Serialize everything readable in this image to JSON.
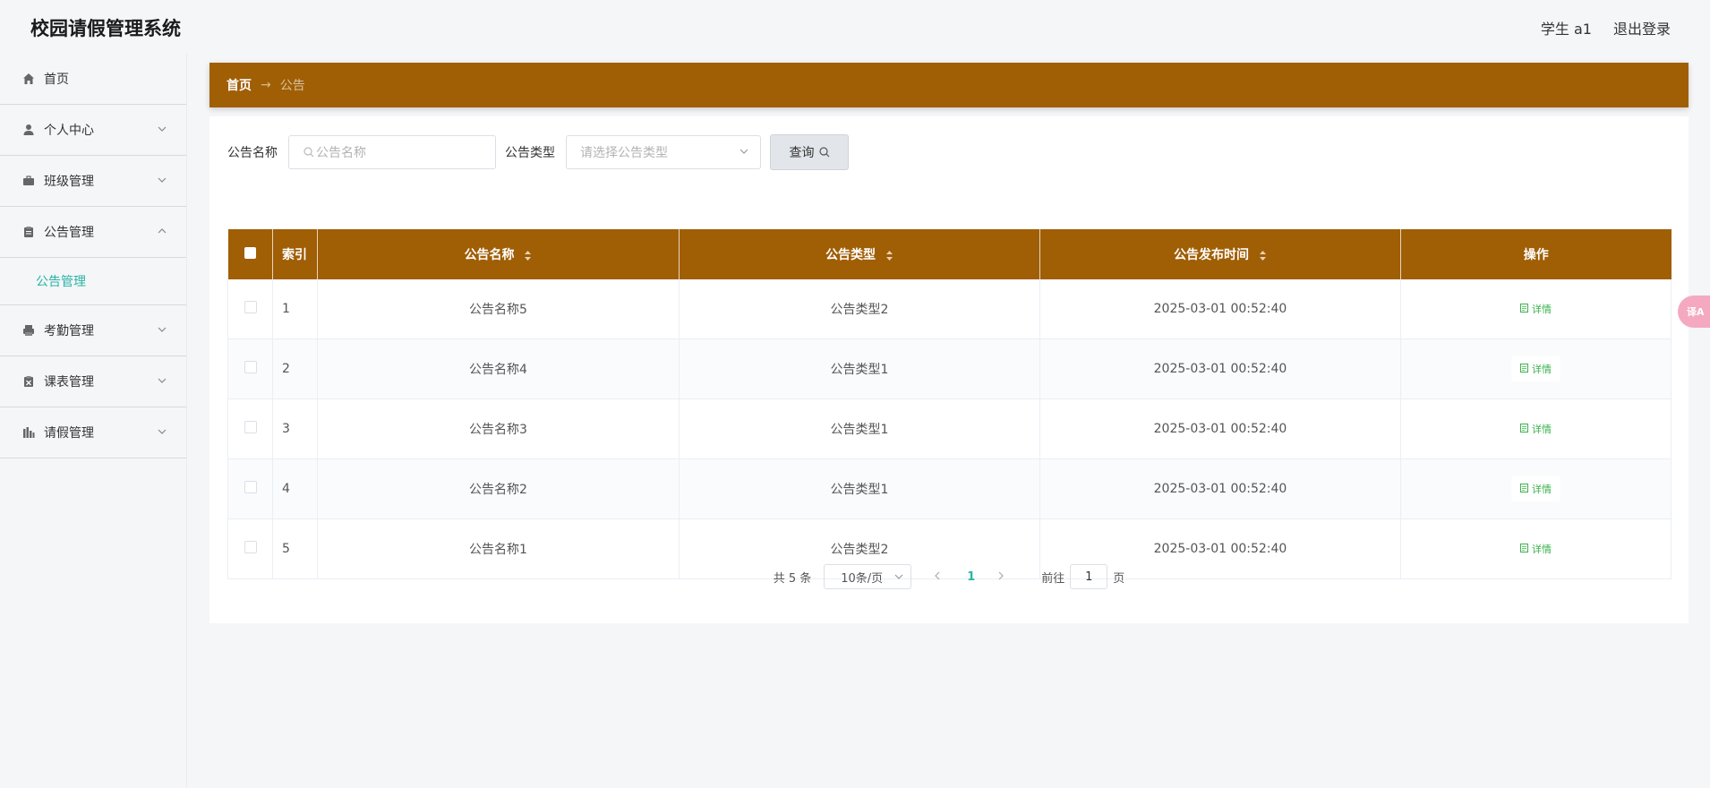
{
  "app": {
    "title": "校园请假管理系统"
  },
  "user": {
    "role_label": "学生 a1",
    "logout_label": "退出登录"
  },
  "sidebar": {
    "items": [
      {
        "label": "首页",
        "icon": "home-icon"
      },
      {
        "label": "个人中心",
        "icon": "user-icon"
      },
      {
        "label": "班级管理",
        "icon": "briefcase-icon"
      },
      {
        "label": "公告管理",
        "icon": "clipboard-icon",
        "expanded": true,
        "children": [
          {
            "label": "公告管理",
            "active": true
          }
        ]
      },
      {
        "label": "考勤管理",
        "icon": "printer-icon"
      },
      {
        "label": "课表管理",
        "icon": "checklist-icon"
      },
      {
        "label": "请假管理",
        "icon": "chart-icon"
      }
    ]
  },
  "breadcrumb": {
    "home": "首页",
    "separator": "→",
    "current": "公告"
  },
  "search": {
    "name_label": "公告名称",
    "name_placeholder": "公告名称",
    "type_label": "公告类型",
    "type_placeholder": "请选择公告类型",
    "query_label": "查询"
  },
  "table": {
    "columns": [
      "索引",
      "公告名称",
      "公告类型",
      "公告发布时间",
      "操作"
    ],
    "action_label": "详情",
    "rows": [
      {
        "index": "1",
        "name": "公告名称5",
        "type": "公告类型2",
        "time": "2025-03-01 00:52:40"
      },
      {
        "index": "2",
        "name": "公告名称4",
        "type": "公告类型1",
        "time": "2025-03-01 00:52:40"
      },
      {
        "index": "3",
        "name": "公告名称3",
        "type": "公告类型1",
        "time": "2025-03-01 00:52:40"
      },
      {
        "index": "4",
        "name": "公告名称2",
        "type": "公告类型1",
        "time": "2025-03-01 00:52:40"
      },
      {
        "index": "5",
        "name": "公告名称1",
        "type": "公告类型2",
        "time": "2025-03-01 00:52:40"
      }
    ]
  },
  "pagination": {
    "total_text": "共 5 条",
    "page_size": "10条/页",
    "current_page": "1",
    "goto_label": "前往",
    "goto_value": "1",
    "page_suffix": "页"
  },
  "float_button": {
    "label": "译A"
  },
  "colors": {
    "accent": "#a05e05",
    "active_text": "#2ab3a5",
    "detail_green": "#3ab04a"
  }
}
